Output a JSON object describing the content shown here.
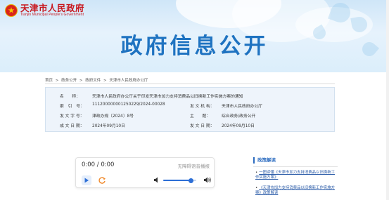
{
  "header": {
    "site_name_cn": "天津市人民政府",
    "site_name_en": "Tianjin Municipal People's Government",
    "banner_title": "政府信息公开"
  },
  "breadcrumb": [
    "首页",
    ">",
    "政务公开",
    ">",
    "政府文件",
    ">",
    "天津市人民政府办公厅"
  ],
  "info": {
    "name_label": "名　　称：",
    "name_value": "天津市人民政府办公厅关于印发天津市加力支持消费品以旧换新工作实施方案的通知",
    "index_label": "索　引　号：",
    "index_value": "111200000001250229/2024-00028",
    "issuer_label": "发 文 机 构：",
    "issuer_value": "天津市人民政府办公厅",
    "doc_no_label": "发 文 字 号：",
    "doc_no_value": "津政办规〔2024〕8号",
    "topic_label": "主　　题：",
    "topic_value": "综合政务\\政务公开",
    "created_label": "成 文 日 期：",
    "created_value": "2024年09月10日",
    "published_label": "发 文 日 期：",
    "published_value": "2024年09月10日"
  },
  "player": {
    "time": "0:00 / 0:00",
    "aria_label": "无障碍语音播报",
    "volume_level": 0.85
  },
  "side": {
    "title": "政策解读",
    "items": [
      "一图读懂《天津市加力支持消费品以旧换新工作实施方案》",
      "《天津市加力支持消费品以旧换新工作实施方案》政策解读"
    ]
  },
  "colors": {
    "brand_red": "#c8161d",
    "title_blue": "#1f73c1",
    "accent_blue": "#2d6fd6"
  }
}
